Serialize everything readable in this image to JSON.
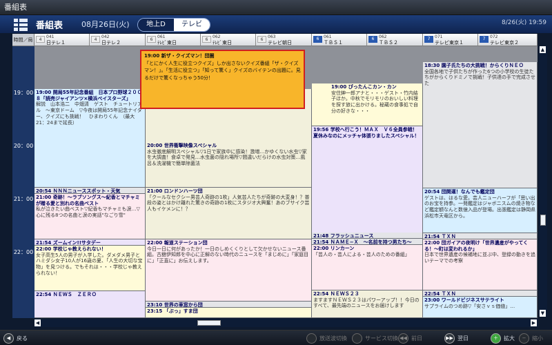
{
  "window": {
    "title": "番組表"
  },
  "header": {
    "title": "番組表",
    "date": "08月26日(火)",
    "bands": [
      "地上D",
      "テレビ"
    ],
    "clock": "8/26(火) 19:59"
  },
  "grid": {
    "time_header": "時間／局",
    "times": [
      "19：00",
      "20：00",
      "21：00",
      "22：00"
    ],
    "channels": [
      {
        "num": "041",
        "name": "日テレ１",
        "logo": "4"
      },
      {
        "num": "042",
        "name": "日テレ２",
        "logo": "4"
      },
      {
        "num": "061",
        "name": "ﾃﾚﾋﾞ東日",
        "logo": "6"
      },
      {
        "num": "062",
        "name": "ﾃﾚﾋﾞ東日",
        "logo": "6"
      },
      {
        "num": "063",
        "name": "テレビ朝日",
        "logo": "6"
      },
      {
        "num": "061",
        "name": "ＴＢＳ１",
        "logo": "6"
      },
      {
        "num": "062",
        "name": "ＴＢＳ２",
        "logo": "6"
      },
      {
        "num": "071",
        "name": "テレビ東京１",
        "logo": "7"
      },
      {
        "num": "072",
        "name": "テレビ東京２",
        "logo": "7"
      }
    ],
    "programs": {
      "p1": {
        "title": "19:00 開局55年記念番組　日本プロ野球２００８「読売ジャイアンツ×横浜ベイスターズ」",
        "desc": "解説　山本浩二　中畑清　ゲスト　チュートリアル　〜東京ドーム　▽今夜は開局55年記念ナイター、クイズにも挑戦！　ひまわりくん　（最大21：24まで延長）"
      },
      "p2": {
        "title": "20:54 ＮＮＮニューススポット・天気"
      },
      "p3": {
        "title": "21:00 奇跡！〜ラブソングス〜紀香とマチャミが贈る愛と別れの名曲ベスト",
        "desc": "私が泣きたい曲ベスト▽紀香もマチャミも涙…▽心に残る8つの名曲と涙の実話\"なごり雪\""
      },
      "p4": {
        "title": "21:54 ズームイン!!サタデー"
      },
      "p5": {
        "title": "22:00 学校じゃ教えられない！",
        "desc": "女子高生5人の男子が入学した。ダメダメ男子とハミダシ女子10人が16歳の夏、「人生の大切な宝物」を見つける。でもそれは・・・学校じゃ教えられない！"
      },
      "p6": {
        "title": "22:54 ＮＥＷＳ　ＺＥＲＯ"
      },
      "p7": {
        "title": "20:00 世界衝撃映像スペシャル",
        "desc": "水虫徹底解明スペシャル▽1日で家族中に感染！激増…かゆくない水虫▽家を大調査！食卓で発見…水虫菌の隠れ場所▽間違いだらけの水虫対策…風呂＆洗濯機で簡単除菌法"
      },
      "p8": {
        "title": "21:00 ロンドンハーツ団",
        "desc": "「クールなセクシー男芸人奇跡の1枚」人気芸人たちが奇跡の大変身！？普段の姿とはかけ離れた驚きの奇跡の1枚にスタジオ大興奮！あのブサイク芸人もイケメンに！？"
      },
      "p9": {
        "title": "22:00 報道ステーション団",
        "desc": "今日一日に何があったか！一日のしめくくりとして欠かせないニュース番組。古舘伊知郎を中心に正解のない時代のニュースを「まじめに」「家庭目に」「正直に」お伝えします。"
      },
      "p10": {
        "title": "23:10 世界の車窓から団"
      },
      "p11": {
        "title": "23:15 「ぶっ」すま団"
      },
      "p12": {
        "title": "19:00 ぴったんこカン・カン",
        "desc": "安住紳一郎アナと・・・ゲスト・竹内結子ほか。中秋でモリモリのおいしい料理を探す旅に出かける。秘蔵の食事処で自分の好きな・・・"
      },
      "p13": {
        "title": "19:56 学校へ行こう！ＭＡＸ　Ｖ６全員参戦！夏休みなのにメッチャ体張りましたスペシャル！"
      },
      "p14": {
        "title": "21:48 フラッシュニュース"
      },
      "p15": {
        "title": "21:54 ＮＡＭＥ−Ｘ　〜名前を持つ男たち〜"
      },
      "p16": {
        "title": "22:00 リンカーン",
        "desc": "「芸人の・芸人による・芸人のための番組」"
      },
      "p17": {
        "title": "22:54 ＮＥＷＳ２３",
        "desc": "ますますＮＥＷＳ２３はパワーアップ！！今日のすべて、最先端のニュースをお届けします"
      },
      "p18": {
        "title": "18:30 園子氏たちの大挑戦！からくりＮＥＯ",
        "desc": "全国各地で子供たちが作った6つの小学校の生徒たちがからくりドミノで挑戦！子供達の手で完成させた"
      },
      "p19": {
        "title": "20:54 団開運！なんでも鑑定団",
        "desc": "ゲストは、はるな愛。芸人ニューハーフが「思い出のお宝を持参。一発鑑定はジャボニスムの焼き物など鑑定額なんと数億入品が登場。出張鑑定は静岡県浜松市天竜区から。"
      },
      "p20": {
        "title": "21:54 ＴＸＮ"
      },
      "p21": {
        "title": "22:00 団ガイアの夜明け「世界遺産がやってくる！〜町は変われるか」",
        "desc": "日本で世界遺産の候補地に並ぶ中、登録の動きを追いテーマでの考察"
      },
      "p22": {
        "title": "22:54 ＴＸＮ"
      },
      "p23": {
        "title": "23:00 ワールドビジネスサテライト",
        "desc": "サプライムのつめ跡▽「安さｖｓ価値」…"
      }
    },
    "popup": {
      "title": "19:00 新ザ・クイズマン！団圏",
      "desc": "「とにかく人生に役立つクイズ」しか出さないクイズ番組「ザ・クイズマン！」。「生活に役立つ」「知って驚く」クイズのバイテンの出題に。見るだけで驚くなっちゃう50分！"
    }
  },
  "footer": {
    "back": "戻る",
    "broadcast_switch": "放送波切換",
    "service_switch": "サービス切換",
    "prev_day": "前日",
    "next_day": "翌日",
    "zoom_in": "拡大",
    "zoom_out": "縮小"
  }
}
